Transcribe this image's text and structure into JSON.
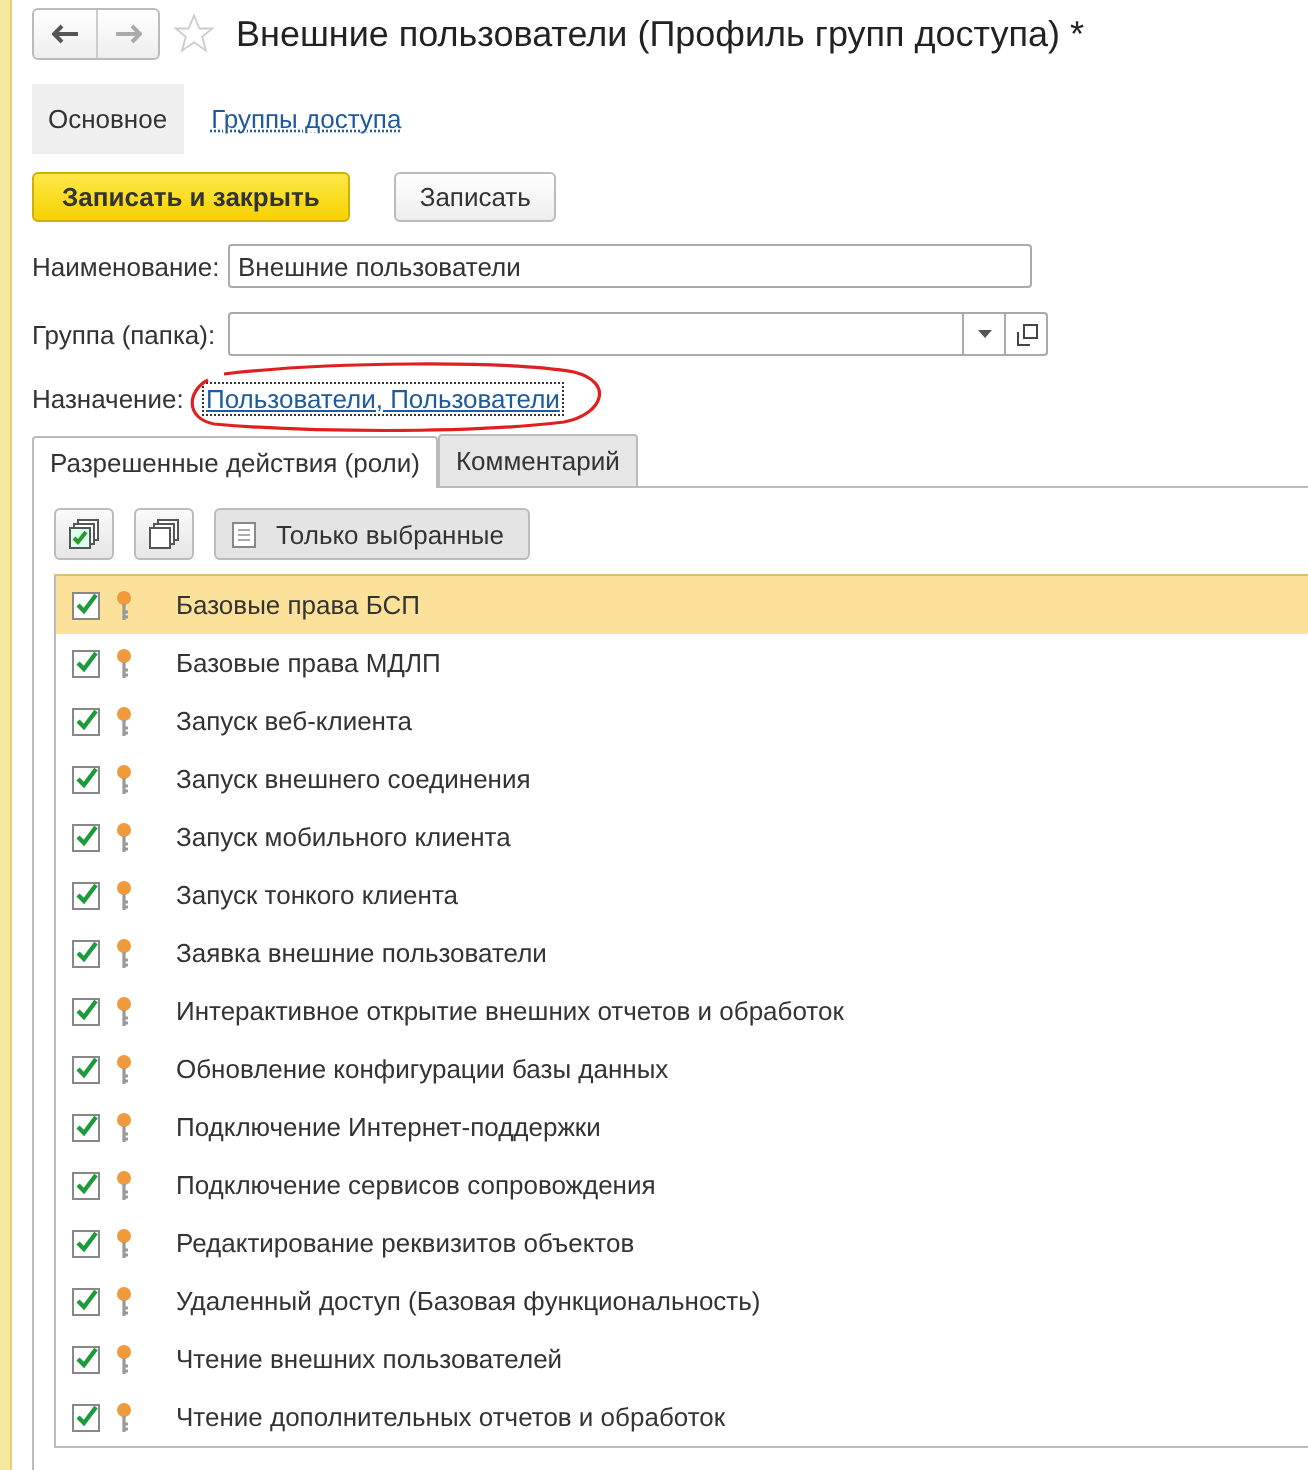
{
  "window": {
    "title": "Внешние пользователи (Профиль групп доступа) *",
    "favorite": false
  },
  "sections": [
    {
      "label": "Основное",
      "selected": true
    },
    {
      "label": "Группы доступа",
      "selected": false
    }
  ],
  "buttons": {
    "primary": "Записать и закрыть",
    "secondary": "Записать"
  },
  "fields": {
    "name_label": "Наименование:",
    "name_value": "Внешние пользователи",
    "group_label": "Группа (папка):",
    "purpose_label": "Назначение:",
    "purpose_link": "Пользователи, Пользователи"
  },
  "tabs": [
    {
      "label": "Разрешенные действия (роли)",
      "selected": true
    },
    {
      "label": "Комментарий",
      "selected": false
    }
  ],
  "toolbar": {
    "filter_label": "Только выбранные"
  },
  "roles": [
    {
      "name": "Базовые права БСП",
      "checked": true,
      "selected": true
    },
    {
      "name": "Базовые права МДЛП",
      "checked": true,
      "selected": false
    },
    {
      "name": "Запуск веб-клиента",
      "checked": true,
      "selected": false
    },
    {
      "name": "Запуск внешнего соединения",
      "checked": true,
      "selected": false
    },
    {
      "name": "Запуск мобильного клиента",
      "checked": true,
      "selected": false
    },
    {
      "name": "Запуск тонкого клиента",
      "checked": true,
      "selected": false
    },
    {
      "name": "Заявка внешние пользователи",
      "checked": true,
      "selected": false
    },
    {
      "name": "Интерактивное открытие внешних отчетов и обработок",
      "checked": true,
      "selected": false
    },
    {
      "name": "Обновление конфигурации базы данных",
      "checked": true,
      "selected": false
    },
    {
      "name": "Подключение Интернет-поддержки",
      "checked": true,
      "selected": false
    },
    {
      "name": "Подключение сервисов сопровождения",
      "checked": true,
      "selected": false
    },
    {
      "name": "Редактирование реквизитов объектов",
      "checked": true,
      "selected": false
    },
    {
      "name": "Удаленный доступ (Базовая функциональность)",
      "checked": true,
      "selected": false
    },
    {
      "name": "Чтение внешних пользователей",
      "checked": true,
      "selected": false
    },
    {
      "name": "Чтение дополнительных отчетов и обработок",
      "checked": true,
      "selected": false
    }
  ]
}
